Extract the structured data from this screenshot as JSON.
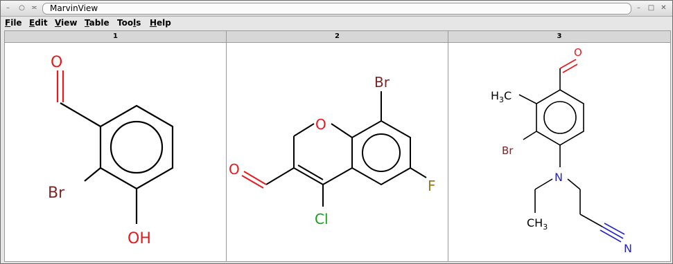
{
  "window": {
    "title": "MarvinView",
    "buttons": {
      "minimize": "–",
      "shade": "○",
      "menu": "≍",
      "iconify": "–",
      "maximize": "□",
      "close": "✕"
    }
  },
  "menu": [
    {
      "label": "File",
      "mnemonic": "F",
      "rest": "ile"
    },
    {
      "label": "Edit",
      "mnemonic": "E",
      "rest": "dit"
    },
    {
      "label": "View",
      "mnemonic": "V",
      "rest": "iew"
    },
    {
      "label": "Table",
      "mnemonic": "T",
      "rest": "able"
    },
    {
      "label": "Tools",
      "mnemonic": "l",
      "pre": "Too",
      "rest": "s"
    },
    {
      "label": "Help",
      "mnemonic": "H",
      "rest": "elp"
    }
  ],
  "table": {
    "columns": [
      "1",
      "2",
      "3"
    ],
    "molecules": [
      {
        "atoms": {
          "o": "O",
          "br": "Br",
          "oh": "OH"
        }
      },
      {
        "atoms": {
          "br": "Br",
          "o_ring": "O",
          "o_ald": "O",
          "f": "F",
          "cl": "Cl"
        }
      },
      {
        "atoms": {
          "o": "O",
          "h3c": "H",
          "h3c_sub": "3",
          "h3c_c": "C",
          "br": "Br",
          "n": "N",
          "ch3": "CH",
          "ch3_sub": "3",
          "n_nitrile": "N"
        }
      }
    ]
  },
  "colors": {
    "oxygen": "#e8181c",
    "bromine": "#7a2626",
    "chlorine": "#14a014",
    "fluorine": "#9a7a14",
    "nitrogen": "#2222c8",
    "bond": "#000000"
  }
}
